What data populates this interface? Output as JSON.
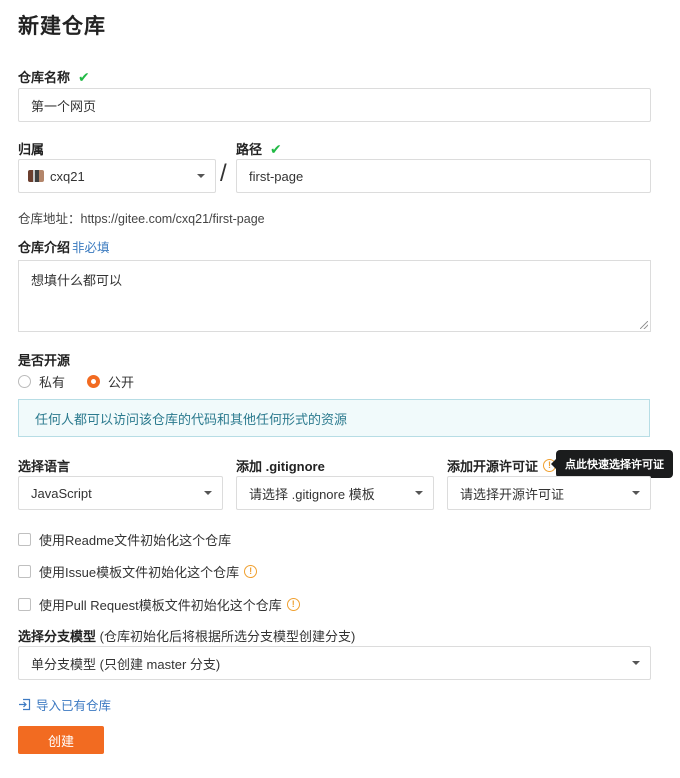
{
  "page_title": "新建仓库",
  "repo_name": {
    "label": "仓库名称",
    "check": "✔",
    "value": "第一个网页"
  },
  "owner": {
    "label": "归属",
    "value": "cxq21"
  },
  "separator": "/",
  "path": {
    "label": "路径",
    "check": "✔",
    "value": "first-page"
  },
  "repo_address": "仓库地址：https://gitee.com/cxq21/first-page",
  "description": {
    "label": "仓库介绍",
    "hint": "非必填",
    "value": "想填什么都可以"
  },
  "open_source": {
    "label": "是否开源",
    "options": [
      {
        "label": "私有",
        "selected": false
      },
      {
        "label": "公开",
        "selected": true
      }
    ],
    "notice": "任何人都可以访问该仓库的代码和其他任何形式的资源"
  },
  "language": {
    "label": "选择语言",
    "value": "JavaScript"
  },
  "gitignore": {
    "label": "添加 .gitignore",
    "value": "请选择 .gitignore 模板"
  },
  "license": {
    "label": "添加开源许可证",
    "value": "请选择开源许可证",
    "tooltip": "点此快速选择许可证"
  },
  "init_options": [
    {
      "label": "使用Readme文件初始化这个仓库",
      "info": false,
      "checked": false
    },
    {
      "label": "使用Issue模板文件初始化这个仓库",
      "info": true,
      "checked": false
    },
    {
      "label": "使用Pull Request模板文件初始化这个仓库",
      "info": true,
      "checked": false
    }
  ],
  "branch_model": {
    "label": "选择分支模型",
    "label_note": "(仓库初始化后将根据所选分支模型创建分支)",
    "value": "单分支模型 (只创建 master 分支)"
  },
  "import_link": "导入已有仓库",
  "create_button": "创建",
  "colors": {
    "accent": "#f26b21",
    "success": "#21ba45",
    "link": "#3d7ac2",
    "info": "#f0a030"
  },
  "icons": {
    "check": "check-icon",
    "info": "info-icon",
    "import": "import-icon",
    "dropdown": "chevron-down-icon"
  }
}
